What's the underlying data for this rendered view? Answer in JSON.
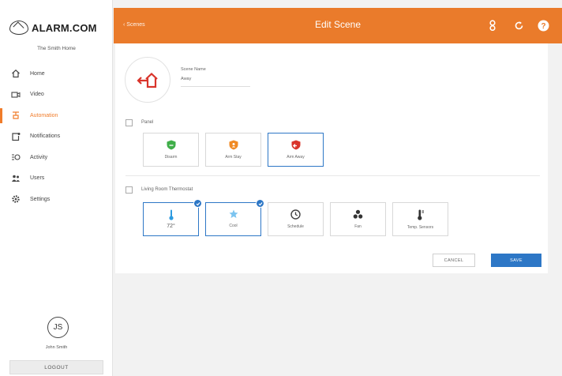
{
  "app": {
    "logo_text": "ALARM.COM",
    "home_name": "The Smith Home"
  },
  "sidebar": {
    "items": [
      {
        "label": "Home",
        "icon": "home-icon"
      },
      {
        "label": "Video",
        "icon": "video-camera-icon"
      },
      {
        "label": "Automation",
        "icon": "automation-icon",
        "active": true
      },
      {
        "label": "Notifications",
        "icon": "notifications-icon"
      },
      {
        "label": "Activity",
        "icon": "activity-icon"
      },
      {
        "label": "Users",
        "icon": "users-icon"
      },
      {
        "label": "Settings",
        "icon": "gear-icon"
      }
    ],
    "user_initials": "JS",
    "user_name": "John Smith",
    "logout_label": "LOGOUT"
  },
  "header": {
    "back_label": "Scenes",
    "title": "Edit Scene"
  },
  "scene": {
    "name_label": "Scene Name",
    "name_value": "Away"
  },
  "panel_section": {
    "label": "Panel",
    "tiles": [
      {
        "label": "Disarm",
        "color": "#3fae49"
      },
      {
        "label": "Arm Stay",
        "color": "#f08a24"
      },
      {
        "label": "Arm Away",
        "color": "#d9342b",
        "selected": true
      }
    ]
  },
  "thermostat_section": {
    "label": "Living Room Thermostat",
    "tiles": [
      {
        "label": "72°",
        "selected": true,
        "kind": "temp"
      },
      {
        "label": "Cool",
        "selected": true,
        "kind": "mode"
      },
      {
        "label": "Schedule",
        "selected": false,
        "kind": "schedule"
      },
      {
        "label": "Fan",
        "selected": false,
        "kind": "fan"
      },
      {
        "label": "Temp. Sensors",
        "selected": false,
        "kind": "sensors"
      }
    ]
  },
  "actions": {
    "cancel_label": "CANCEL",
    "save_label": "SAVE"
  },
  "colors": {
    "accent": "#ea7b2b",
    "primary": "#2d77c6"
  }
}
